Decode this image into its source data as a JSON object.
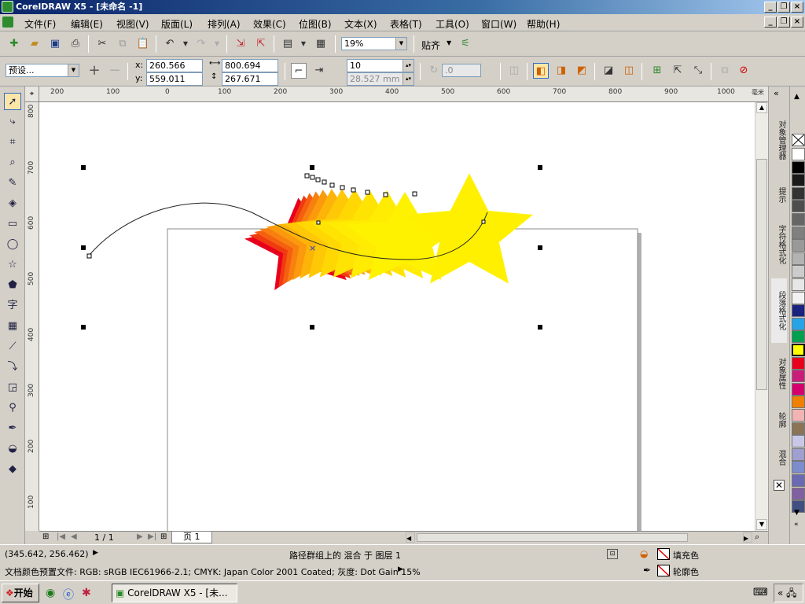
{
  "window": {
    "title": "CorelDRAW X5 - [未命名 -1]"
  },
  "menu": [
    "文件(F)",
    "编辑(E)",
    "视图(V)",
    "版面(L)",
    "排列(A)",
    "效果(C)",
    "位图(B)",
    "文本(X)",
    "表格(T)",
    "工具(O)",
    "窗口(W)",
    "帮助(H)"
  ],
  "toolbar": {
    "zoom": "19%",
    "snap_label": "贴齐"
  },
  "propbar": {
    "preset": "预设...",
    "x_label": "x:",
    "x": "260.566 mm",
    "y_label": "y:",
    "y": "559.011 mm",
    "w": "800.694 mm",
    "h": "267.671 mm",
    "steps": "10",
    "spacing": "28.527 mm",
    "angle": ".0"
  },
  "hruler": [
    "200",
    "100",
    "0",
    "100",
    "200",
    "300",
    "400",
    "500",
    "600",
    "700",
    "800",
    "900",
    "1000"
  ],
  "hruler_unit": "毫米",
  "vruler": [
    "800",
    "700",
    "600",
    "500",
    "400",
    "300",
    "200",
    "100"
  ],
  "pages": {
    "counter": "1 / 1",
    "tab": "页 1"
  },
  "dockers": [
    "对象管理器",
    "提示",
    "字符格式化",
    "段落格式化",
    "对象属性",
    "轮廓",
    "混合"
  ],
  "palette": [
    "#ffffff",
    "#000000",
    "#1a1a1a",
    "#333333",
    "#4d4d4d",
    "#666666",
    "#808080",
    "#999999",
    "#b3b3b3",
    "#cccccc",
    "#e6e6e6",
    "#f2f2f2",
    "#1a237e",
    "#29a3e8",
    "#00a050",
    "#ffff00",
    "#e8001c",
    "#c81e7a",
    "#d4006e",
    "#f08000",
    "#f2b3b3",
    "#8b7355",
    "#c8c8e6",
    "#9f9fd0",
    "#7c8ccc",
    "#6a6ab4",
    "#8060a0",
    "#405080"
  ],
  "status": {
    "coords": "(345.642, 256.462)",
    "info": "路径群组上的 混合 于 图层 1",
    "fill_label": "填充色",
    "outline_label": "轮廓色",
    "profile": "文档颜色预置文件: RGB: sRGB IEC61966-2.1; CMYK: Japan Color 2001 Coated; 灰度: Dot Gain 15%"
  },
  "taskbar": {
    "start": "开始",
    "task": "CorelDRAW X5 - [未..."
  }
}
